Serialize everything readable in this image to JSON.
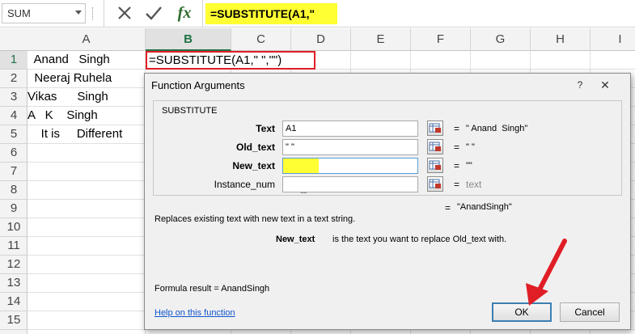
{
  "formula_bar": {
    "name_box": "SUM",
    "fx_label": "fx",
    "formula": "=SUBSTITUTE(A1,\" \",\"\")"
  },
  "sheet": {
    "columns": [
      "A",
      "B",
      "C",
      "D",
      "E",
      "F",
      "G",
      "H",
      "I"
    ],
    "active_column": "B",
    "rows": [
      "1",
      "2",
      "3",
      "4",
      "5",
      "6",
      "7",
      "8",
      "9",
      "10",
      "11",
      "12",
      "13",
      "14",
      "15"
    ],
    "active_row": "1",
    "cells": {
      "A1": "  Anand   Singh",
      "A2": "  Neeraj Ruhela",
      "A3": "Vikas      Singh",
      "A4": "A   K    Singh",
      "A5": "    It is     Different",
      "B1": "=SUBSTITUTE(A1,\" \",\"\")"
    }
  },
  "dialog": {
    "title": "Function Arguments",
    "help_button": "?",
    "close_button": "✕",
    "function_name": "SUBSTITUTE",
    "arguments": [
      {
        "label": "Text",
        "value": "A1",
        "result": "\" Anand  Singh\"",
        "bold": true
      },
      {
        "label": "Old_text",
        "value": "\" \"",
        "result": "\" \"",
        "bold": true
      },
      {
        "label": "New_text",
        "value": "\"\"",
        "result": "\"\"",
        "bold": true
      },
      {
        "label": "Instance_num",
        "value": "",
        "result": "text",
        "bold": false
      }
    ],
    "equals": "=",
    "result_value": "\"AnandSingh\"",
    "description": "Replaces existing text with new text in a text string.",
    "argument_help_name": "New_text",
    "argument_help_text": "is the text you want to replace Old_text with.",
    "formula_result": "Formula result =    AnandSingh",
    "help_link": "Help on this function",
    "ok_label": "OK",
    "cancel_label": "Cancel"
  },
  "colors": {
    "highlight": "#ffff33",
    "cell_outline": "#e01e26",
    "active_header": "#217346",
    "annotation_arrow": "#e01e26"
  }
}
